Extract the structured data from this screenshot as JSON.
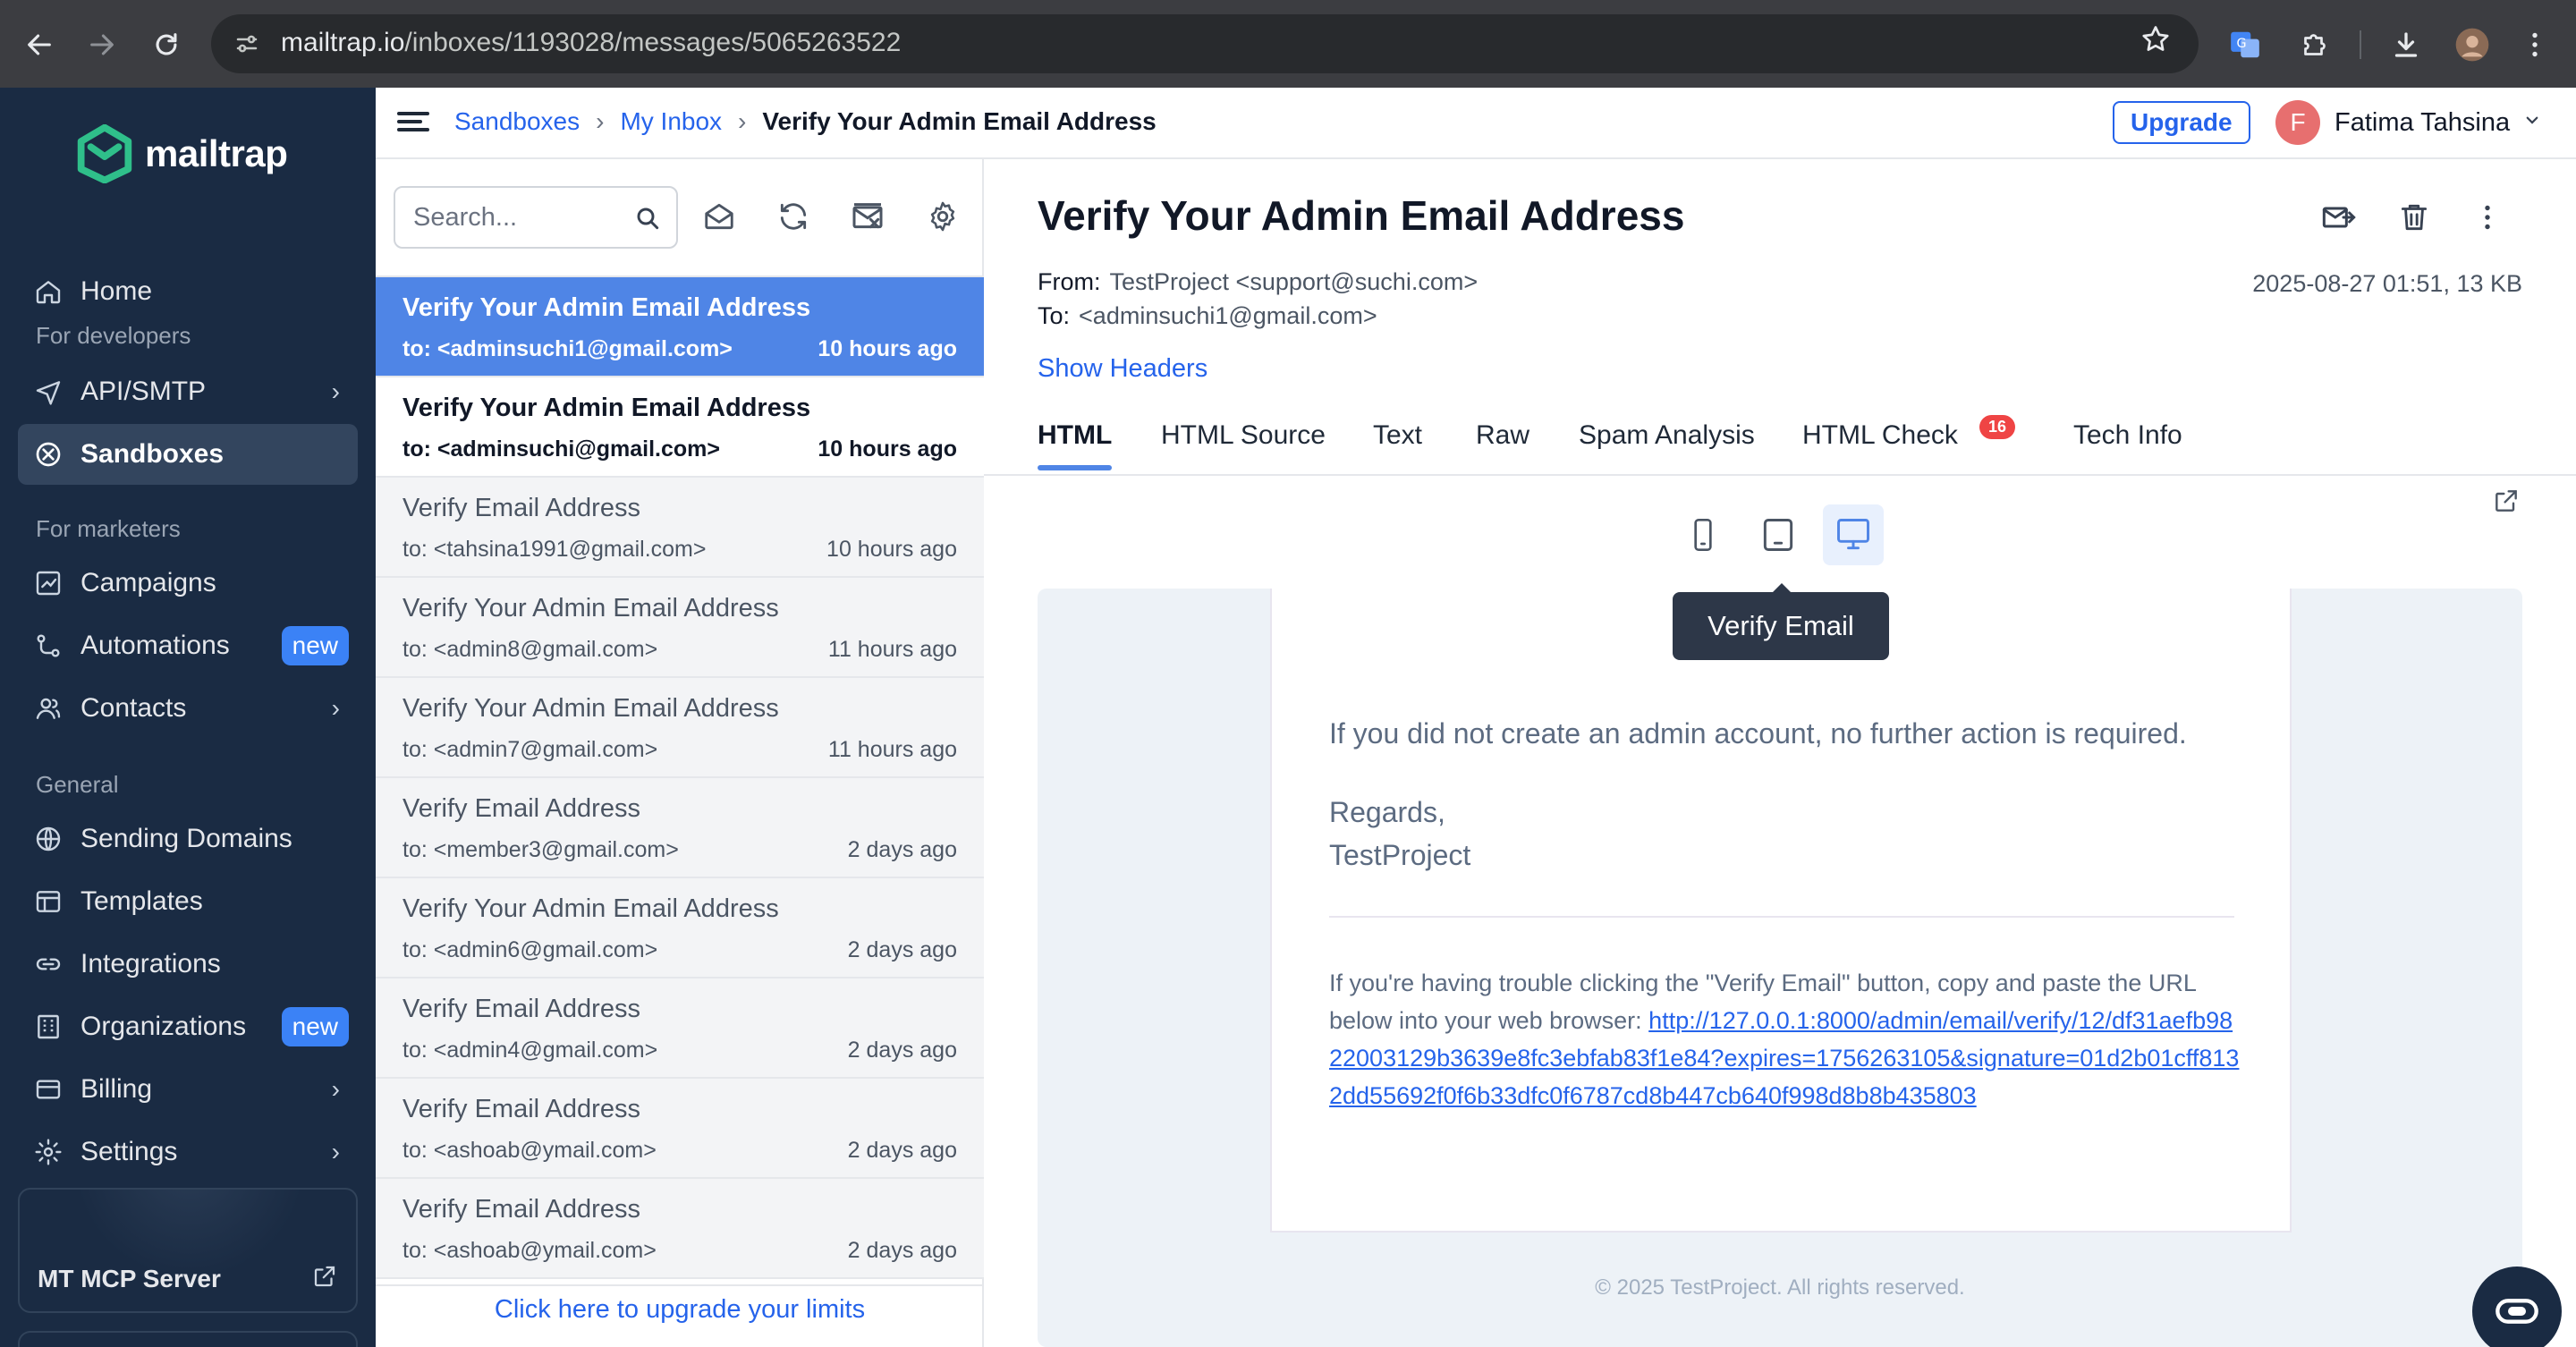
{
  "browser": {
    "url_host": "mailtrap.io",
    "url_path": "/inboxes/1193028/messages/5065263522"
  },
  "sidebar": {
    "logo_text": "mailtrap",
    "home": "Home",
    "section_developers": "For developers",
    "api_smtp": "API/SMTP",
    "sandboxes": "Sandboxes",
    "section_marketers": "For marketers",
    "campaigns": "Campaigns",
    "automations": "Automations",
    "automations_badge": "new",
    "contacts": "Contacts",
    "section_general": "General",
    "sending_domains": "Sending Domains",
    "templates": "Templates",
    "integrations": "Integrations",
    "organizations": "Organizations",
    "organizations_badge": "new",
    "billing": "Billing",
    "settings": "Settings",
    "mcp_label": "MT MCP Server"
  },
  "topbar": {
    "breadcrumb": [
      "Sandboxes",
      "My Inbox",
      "Verify Your Admin Email Address"
    ],
    "upgrade": "Upgrade",
    "user_initial": "F",
    "user_name": "Fatima Tahsina"
  },
  "list": {
    "search_placeholder": "Search...",
    "messages": [
      {
        "subject": "Verify Your Admin Email Address",
        "to": "to: <adminsuchi1@gmail.com>",
        "time": "10 hours ago"
      },
      {
        "subject": "Verify Your Admin Email Address",
        "to": "to: <adminsuchi@gmail.com>",
        "time": "10 hours ago"
      },
      {
        "subject": "Verify Email Address",
        "to": "to: <tahsina1991@gmail.com>",
        "time": "10 hours ago"
      },
      {
        "subject": "Verify Your Admin Email Address",
        "to": "to: <admin8@gmail.com>",
        "time": "11 hours ago"
      },
      {
        "subject": "Verify Your Admin Email Address",
        "to": "to: <admin7@gmail.com>",
        "time": "11 hours ago"
      },
      {
        "subject": "Verify Email Address",
        "to": "to: <member3@gmail.com>",
        "time": "2 days ago"
      },
      {
        "subject": "Verify Your Admin Email Address",
        "to": "to: <admin6@gmail.com>",
        "time": "2 days ago"
      },
      {
        "subject": "Verify Email Address",
        "to": "to: <admin4@gmail.com>",
        "time": "2 days ago"
      },
      {
        "subject": "Verify Email Address",
        "to": "to: <ashoab@ymail.com>",
        "time": "2 days ago"
      },
      {
        "subject": "Verify Email Address",
        "to": "to: <ashoab@ymail.com>",
        "time": "2 days ago"
      }
    ],
    "upgrade_limits": "Click here to upgrade your limits"
  },
  "detail": {
    "title": "Verify Your Admin Email Address",
    "from_label": "From:",
    "from_value": "TestProject <support@suchi.com>",
    "to_label": "To:",
    "to_value": "<adminsuchi1@gmail.com>",
    "meta": "2025-08-27 01:51, 13 KB",
    "show_headers": "Show Headers",
    "tabs": [
      "HTML",
      "HTML Source",
      "Text",
      "Raw",
      "Spam Analysis",
      "HTML Check",
      "Tech Info"
    ],
    "html_check_count": "16",
    "tooltip": "Verify Email"
  },
  "email": {
    "line1": "If you did not create an admin account, no further action is required.",
    "regards": "Regards,",
    "sender": "TestProject",
    "trouble_text": "If you're having trouble clicking the \"Verify Email\" button, copy and paste the URL below into your web browser: ",
    "link": "http://127.0.0.1:8000/admin/email/verify/12/df31aefb9822003129b3639e8fc3ebfab83f1e84?expires=1756263105&signature=01d2b01cff8132dd55692f0f6b33dfc0f6787cd8b447cb640f998d8b8b435803",
    "footer": "© 2025 TestProject. All rights reserved."
  },
  "colors": {
    "sidebar_bg": "#1a2b43",
    "accent": "#2563eb",
    "selected_row": "#4f85e6",
    "logo_green": "#2fbf8a"
  }
}
